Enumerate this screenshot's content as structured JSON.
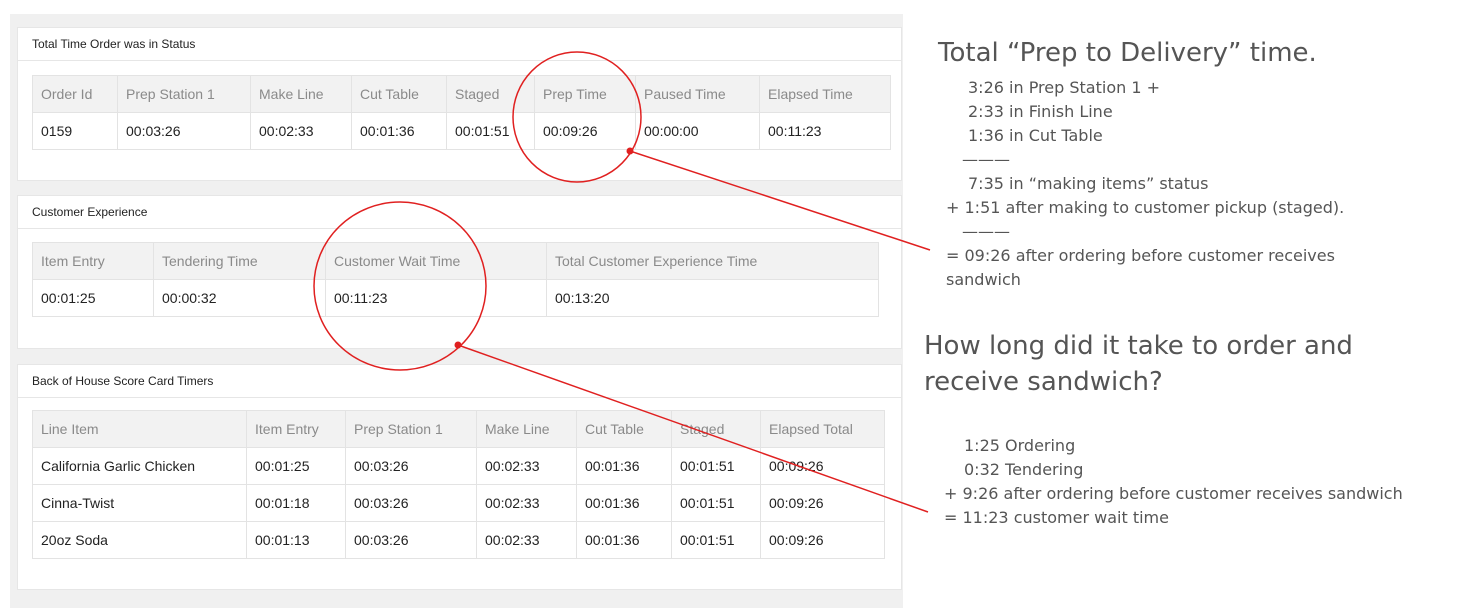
{
  "panels": {
    "status": {
      "title": "Total Time Order was in Status",
      "headers": [
        "Order Id",
        "Prep Station 1",
        "Make Line",
        "Cut Table",
        "Staged",
        "Prep Time",
        "Paused Time",
        "Elapsed Time"
      ],
      "row": [
        "0159",
        "00:03:26",
        "00:02:33",
        "00:01:36",
        "00:01:51",
        "00:09:26",
        "00:00:00",
        "00:11:23"
      ]
    },
    "customer": {
      "title": "Customer Experience",
      "headers": [
        "Item Entry",
        "Tendering Time",
        "Customer Wait Time",
        "Total Customer Experience Time"
      ],
      "row": [
        "00:01:25",
        "00:00:32",
        "00:11:23",
        "00:13:20"
      ]
    },
    "boh": {
      "title": "Back of House Score Card Timers",
      "headers": [
        "Line Item",
        "Item Entry",
        "Prep Station 1",
        "Make Line",
        "Cut Table",
        "Staged",
        "Elapsed Total"
      ],
      "rows": [
        [
          "California Garlic Chicken",
          "00:01:25",
          "00:03:26",
          "00:02:33",
          "00:01:36",
          "00:01:51",
          "00:09:26"
        ],
        [
          "Cinna-Twist",
          "00:01:18",
          "00:03:26",
          "00:02:33",
          "00:01:36",
          "00:01:51",
          "00:09:26"
        ],
        [
          "20oz Soda",
          "00:01:13",
          "00:03:26",
          "00:02:33",
          "00:01:36",
          "00:01:51",
          "00:09:26"
        ]
      ]
    }
  },
  "annotations": {
    "prep": {
      "heading": "Total “Prep to Delivery” time.",
      "lines": [
        "3:26 in Prep Station 1 +",
        "2:33 in Finish Line",
        "1:36 in Cut Table",
        "———",
        "7:35 in “making items” status",
        "+  1:51 after making to customer pickup (staged).",
        "———",
        "= 09:26 after ordering before customer receives",
        "sandwich"
      ]
    },
    "order": {
      "heading_1": "How long did it take to order and",
      "heading_2": "receive sandwich?",
      "lines": [
        "1:25 Ordering",
        "0:32 Tendering",
        "+  9:26 after ordering before customer receives sandwich",
        "= 11:23 customer wait time"
      ]
    },
    "accent_color": "#e02020"
  }
}
